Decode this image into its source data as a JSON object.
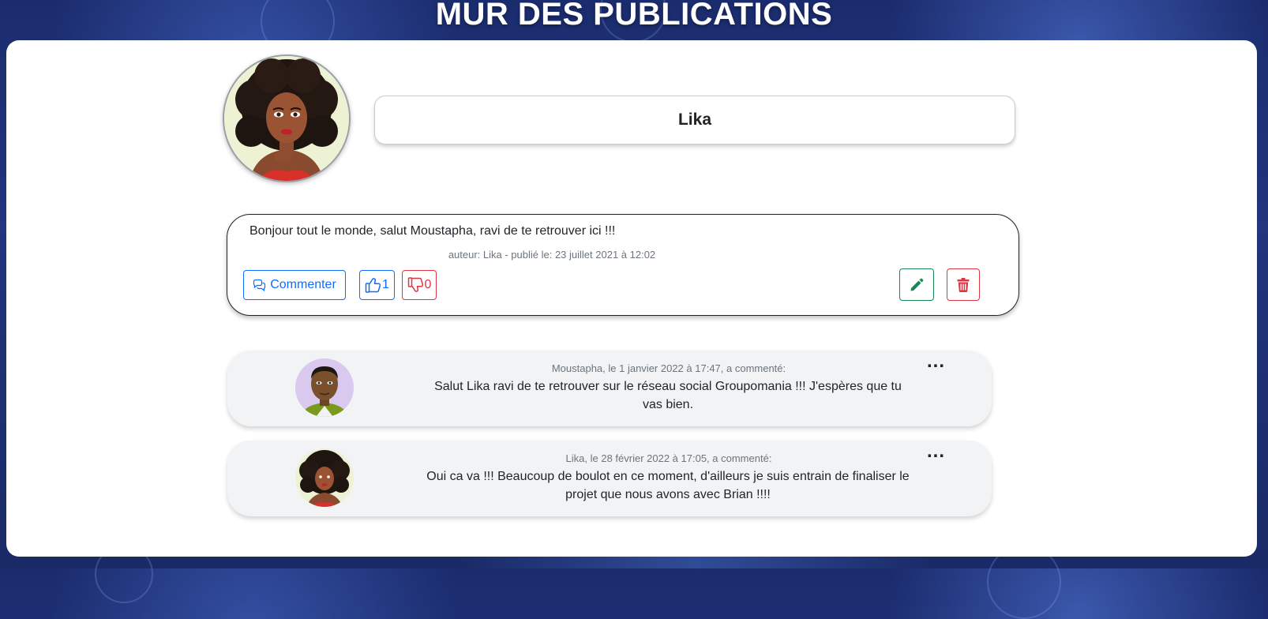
{
  "page": {
    "title": "MUR DES PUBLICATIONS"
  },
  "profile": {
    "name": "Lika"
  },
  "post": {
    "text": "Bonjour tout le monde, salut Moustapha, ravi de te retrouver ici !!!",
    "meta": "auteur: Lika - publié le: 23 juillet 2021 à 12:02",
    "comment_button_label": "Commenter",
    "likes": "1",
    "dislikes": "0"
  },
  "comments": [
    {
      "meta": "Moustapha, le 1 janvier 2022 à 17:47, a commenté:",
      "text": "Salut Lika ravi de te retrouver sur le réseau social Groupomania !!! J'espères que tu vas bien.",
      "menu": "..."
    },
    {
      "meta": "Lika, le 28 février 2022 à 17:05, a commenté:",
      "text": "Oui ca va !!! Beaucoup de boulot en ce moment, d'ailleurs je suis entrain de finaliser le projet que nous avons avec Brian !!!!",
      "menu": "..."
    }
  ],
  "colors": {
    "primary": "#0d6efd",
    "danger": "#dc3545",
    "success": "#198754"
  },
  "icons": {
    "comment": "comments-icon",
    "like": "thumbs-up-icon",
    "dislike": "thumbs-down-icon",
    "edit": "pencil-icon",
    "delete": "trash-icon"
  }
}
